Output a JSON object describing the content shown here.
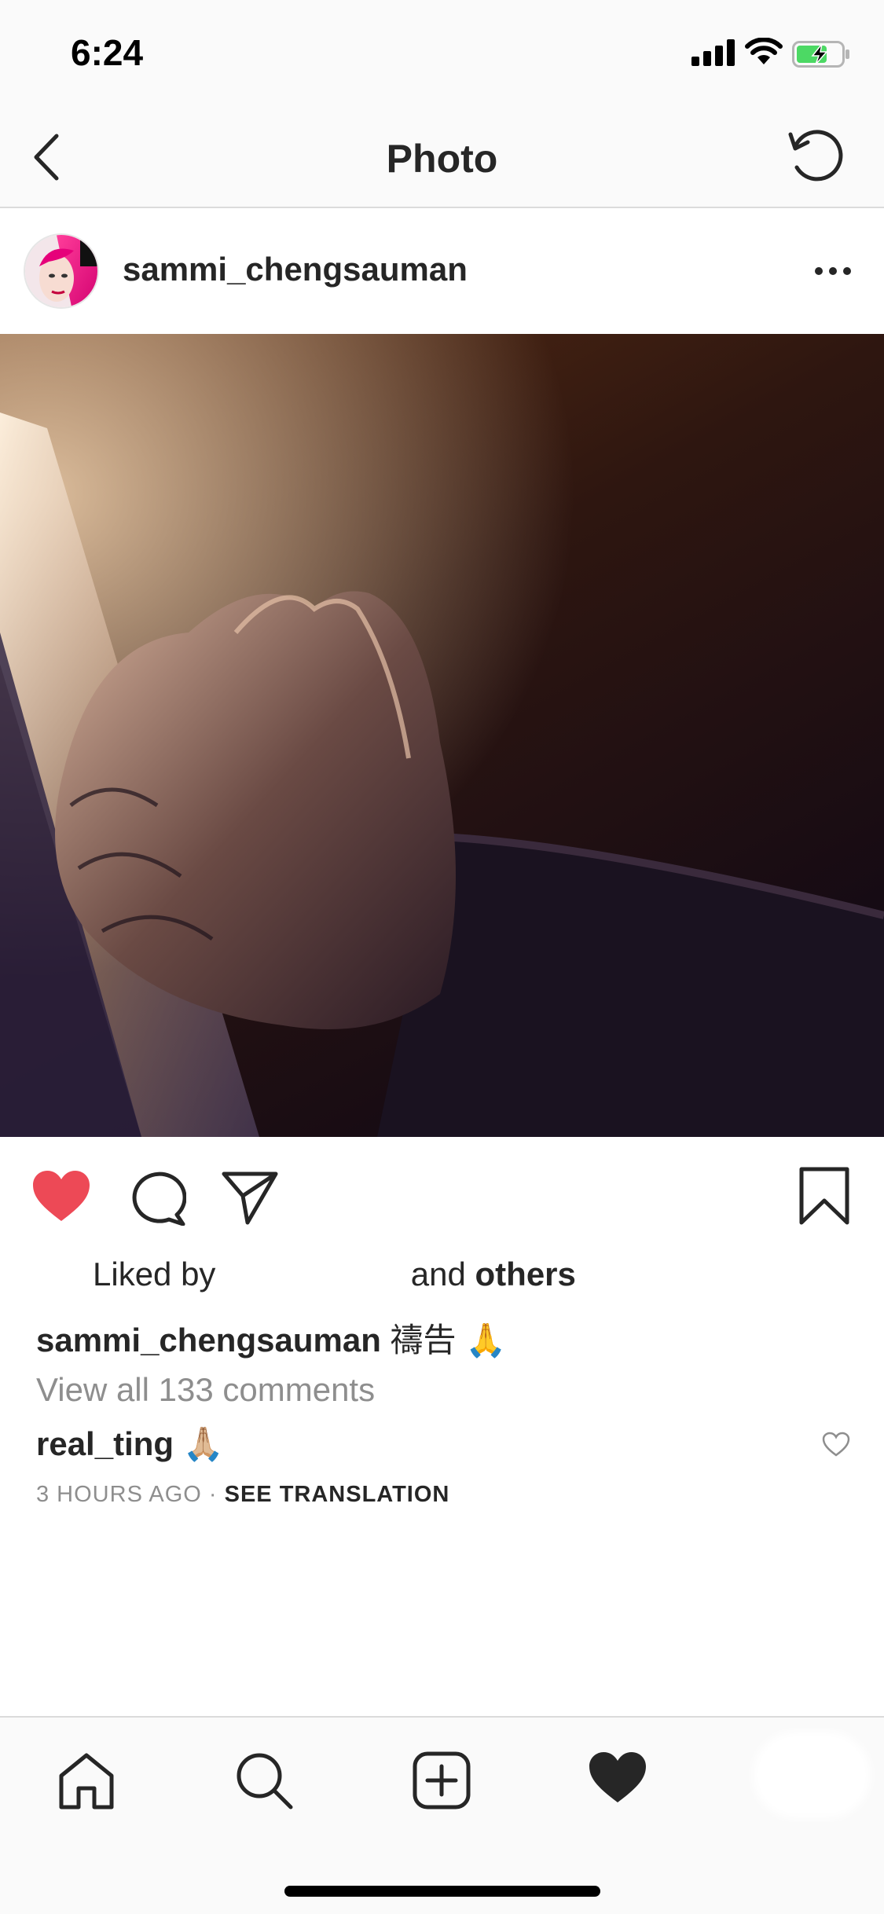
{
  "status_bar": {
    "time": "6:24"
  },
  "nav": {
    "title": "Photo"
  },
  "post": {
    "username": "sammi_chengsauman",
    "image_alt": "Clasped hands in prayer lit by a warm light",
    "likes": {
      "prefix": "Liked by",
      "middle": "and",
      "suffix": "others"
    },
    "caption": {
      "username": "sammi_chengsauman",
      "text": "禱告 🙏"
    },
    "view_all": "View all 133 comments",
    "comment": {
      "username": "real_ting",
      "text": "🙏🏼"
    },
    "time_ago": "3 HOURS AGO",
    "separator": " · ",
    "see_translation": "SEE TRANSLATION"
  },
  "colors": {
    "like_red": "#ed4956",
    "text": "#262626",
    "muted": "#8e8e8e"
  }
}
